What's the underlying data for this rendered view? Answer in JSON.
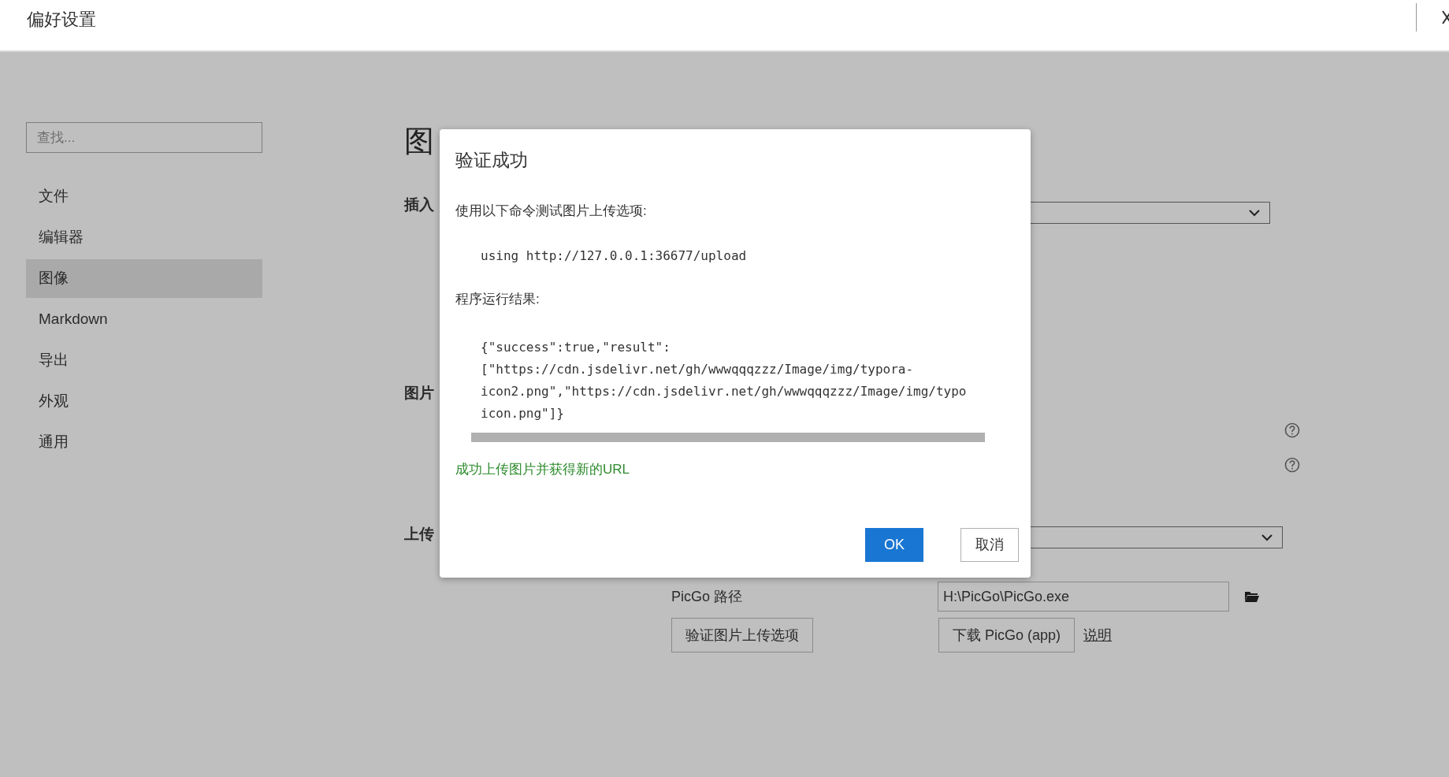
{
  "window": {
    "title": "偏好设置"
  },
  "search": {
    "placeholder": "查找..."
  },
  "sidebar": {
    "items": [
      {
        "label": "文件",
        "selected": false
      },
      {
        "label": "编辑器",
        "selected": false
      },
      {
        "label": "图像",
        "selected": true
      },
      {
        "label": "Markdown",
        "selected": false
      },
      {
        "label": "导出",
        "selected": false
      },
      {
        "label": "外观",
        "selected": false
      },
      {
        "label": "通用",
        "selected": false
      }
    ]
  },
  "content": {
    "heading": "图",
    "sections": [
      "插入",
      "图片",
      "上传"
    ],
    "picgo_path": {
      "label": "PicGo 路径",
      "value": "H:\\PicGo\\PicGo.exe"
    },
    "buttons": [
      "验证图片上传选项",
      "下载 PicGo (app)"
    ],
    "link": "说明"
  },
  "dialog": {
    "title": "验证成功",
    "prompt": "使用以下命令测试图片上传选项:",
    "command": "using http://127.0.0.1:36677/upload",
    "result_label": "程序运行结果:",
    "result_lines": [
      "{\"success\":true,\"result\":",
      "[\"https://cdn.jsdelivr.net/gh/wwwqqqzzz/Image/img/typora-",
      "icon2.png\",\"https://cdn.jsdelivr.net/gh/wwwqqqzzz/Image/img/typo",
      "icon.png\"]}"
    ],
    "status": "成功上传图片并获得新的URL",
    "buttons": [
      {
        "label": "OK",
        "kind": "primary"
      },
      {
        "label": "取消",
        "kind": "secondary"
      }
    ]
  }
}
